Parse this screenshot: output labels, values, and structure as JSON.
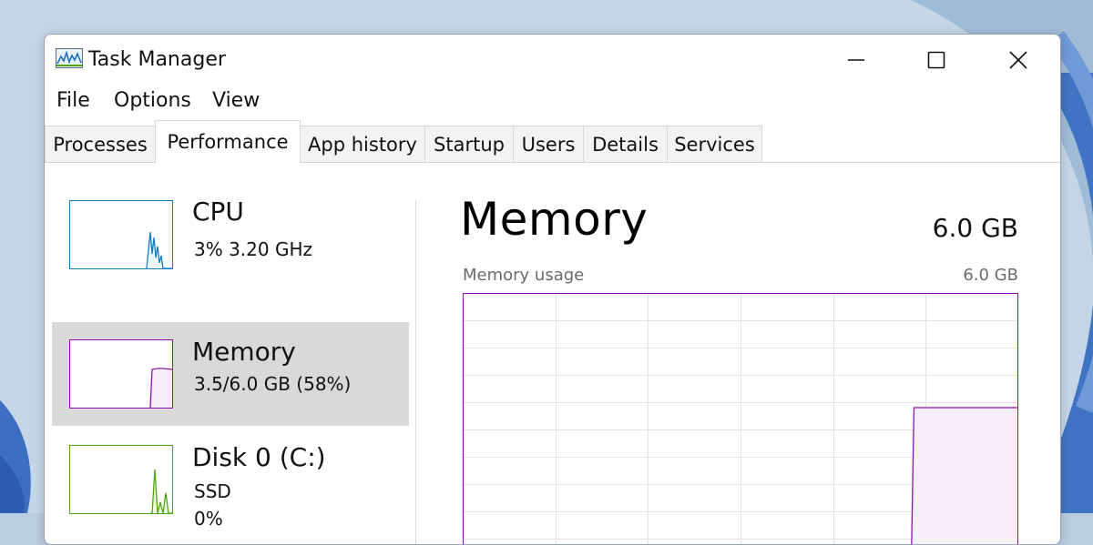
{
  "window": {
    "title": "Task Manager"
  },
  "icons": {
    "app": "task-manager-icon",
    "minimize": "minimize-icon",
    "maximize": "maximize-icon",
    "close": "close-icon"
  },
  "menu": [
    "File",
    "Options",
    "View"
  ],
  "tabs": [
    {
      "label": "Processes",
      "active": false
    },
    {
      "label": "Performance",
      "active": true
    },
    {
      "label": "App history",
      "active": false
    },
    {
      "label": "Startup",
      "active": false
    },
    {
      "label": "Users",
      "active": false
    },
    {
      "label": "Details",
      "active": false
    },
    {
      "label": "Services",
      "active": false
    }
  ],
  "sidebar": {
    "items": [
      {
        "name": "CPU",
        "line1": "3%  3.20 GHz",
        "color": "#117dbb",
        "selected": false
      },
      {
        "name": "Memory",
        "line1": "3.5/6.0 GB (58%)",
        "color": "#8b12ae",
        "selected": true
      },
      {
        "name": "Disk 0 (C:)",
        "line1": "SSD",
        "line2": "0%",
        "color": "#4da60c",
        "selected": false
      }
    ]
  },
  "main": {
    "title": "Memory",
    "total": "6.0 GB",
    "graph_label": "Memory usage",
    "graph_max": "6.0 GB",
    "accent": "#8b12ae",
    "fill": "#f4f0f6",
    "usage_trace": [
      null,
      null,
      null,
      null,
      null,
      null,
      null,
      null,
      null,
      null,
      null,
      null,
      null,
      null,
      null,
      null,
      null,
      null,
      null,
      null,
      null,
      null,
      null,
      null,
      null,
      null,
      null,
      null,
      null,
      null,
      null,
      null,
      null,
      null,
      null,
      null,
      null,
      null,
      null,
      null,
      null,
      null,
      null,
      null,
      null,
      null,
      null,
      null,
      0.58,
      0.58,
      0.58,
      0.58,
      0.58,
      0.58,
      0.58,
      0.58,
      0.58,
      0.58,
      0.58,
      0.58
    ]
  }
}
